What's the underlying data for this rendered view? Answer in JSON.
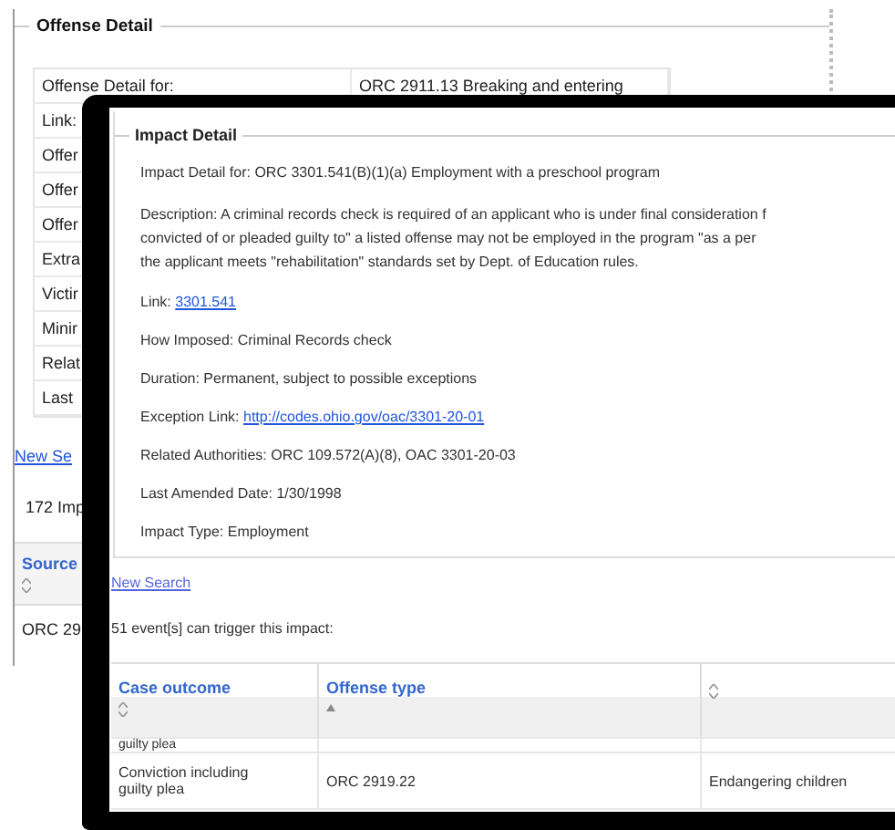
{
  "offense_panel": {
    "title": "Offense Detail",
    "rows": [
      {
        "label": "Offense Detail for:",
        "value": "ORC 2911.13 Breaking and entering"
      },
      {
        "label": "Link:"
      },
      {
        "label": "Offer"
      },
      {
        "label": "Offer"
      },
      {
        "label": "Offer"
      },
      {
        "label": "Extra"
      },
      {
        "label": "Victir"
      },
      {
        "label": "Minir"
      },
      {
        "label": "Relat"
      },
      {
        "label": "Last"
      }
    ],
    "new_search_link": "New Se",
    "impact_count": "172 Imp",
    "table": {
      "columns": [
        {
          "label": "Source",
          "sorted": false
        }
      ],
      "rows": [
        [
          "ORC 29"
        ]
      ]
    }
  },
  "impact_window": {
    "title": "Impact Detail",
    "lines": [
      {
        "kind": "text",
        "text": "Impact Detail for: ORC 3301.541(B)(1)(a) Employment with a preschool program"
      },
      {
        "kind": "paragraph",
        "text": "Description: A criminal records check is required of an applicant who is under final consideration f\nconvicted of or pleaded guilty to\" a listed offense may not be employed in the program \"as a per\nthe applicant meets \"rehabilitation\" standards set by Dept. of Education rules."
      },
      {
        "kind": "link",
        "label": "Link:",
        "link": "3301.541"
      },
      {
        "kind": "text",
        "text": "How Imposed: Criminal Records check"
      },
      {
        "kind": "text",
        "text": "Duration: Permanent, subject to possible exceptions"
      },
      {
        "kind": "link",
        "label": "Exception Link:",
        "link": "http://codes.ohio.gov/oac/3301-20-01"
      },
      {
        "kind": "text",
        "text": "Related Authorities: ORC 109.572(A)(8), OAC 3301-20-03"
      },
      {
        "kind": "text",
        "text": "Last Amended Date: 1/30/1998"
      },
      {
        "kind": "text",
        "text": "Impact Type: Employment"
      }
    ],
    "new_search_link": "New Search",
    "event_count": "51 event[s] can trigger this impact:",
    "table": {
      "columns": [
        {
          "label": "Case outcome",
          "sorted": false
        },
        {
          "label": "Offense type",
          "sorted": true
        },
        {
          "sorted": false
        }
      ],
      "rows": [
        [
          "guilty plea",
          "",
          ""
        ],
        [
          "Conviction including guilty plea",
          "ORC 2919.22",
          "Endangering children"
        ]
      ]
    }
  }
}
